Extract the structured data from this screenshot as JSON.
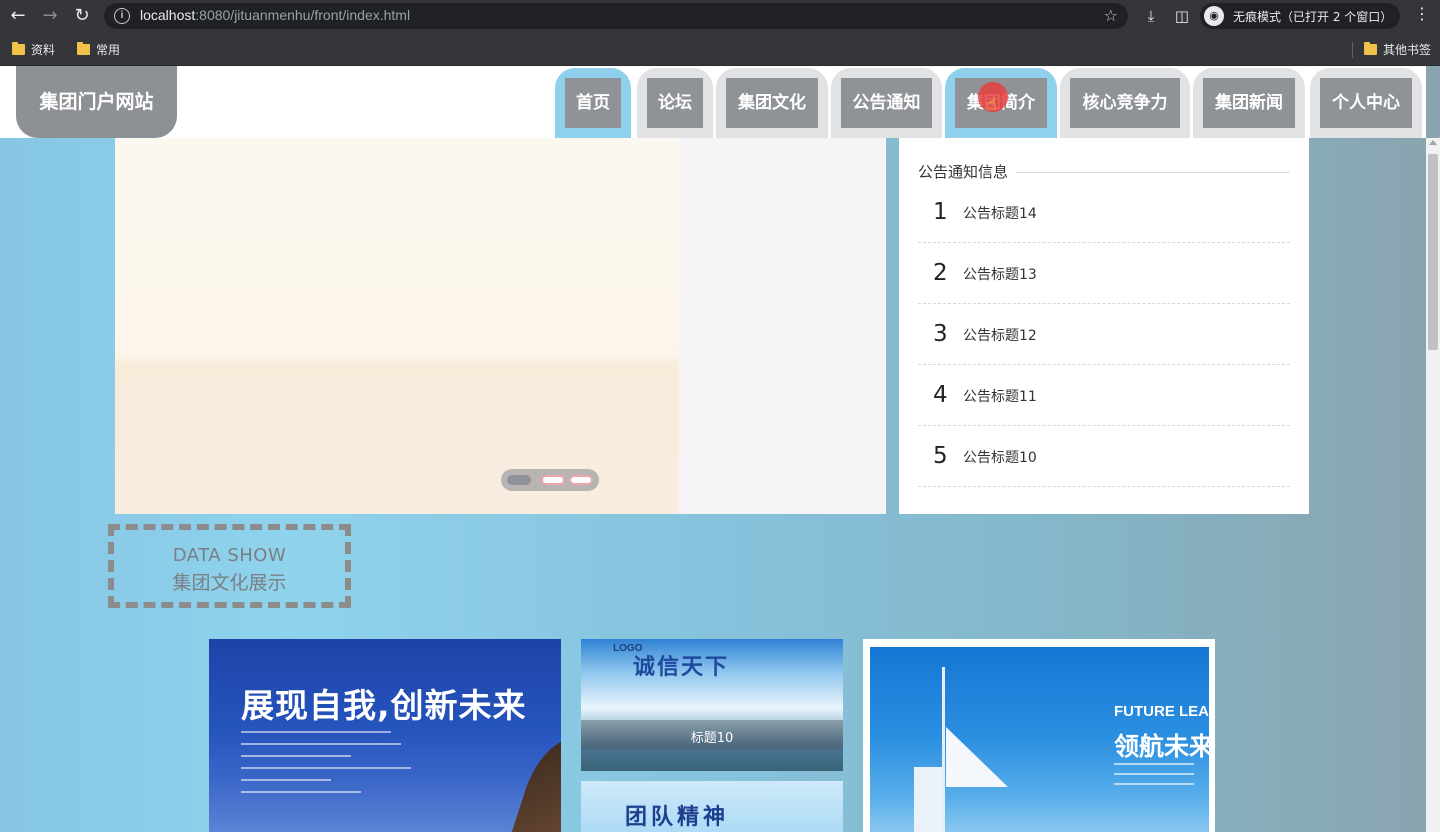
{
  "browser": {
    "url_host": "localhost",
    "url_rest": ":8080/jituanmenhu/front/index.html",
    "incognito_label": "无痕模式（已打开 2 个窗口）",
    "bookmarks": [
      "资料",
      "常用"
    ],
    "other_bookmarks": "其他书签"
  },
  "header": {
    "site_title": "集团门户网站",
    "nav": [
      "首页",
      "论坛",
      "集团文化",
      "公告通知",
      "集团简介",
      "核心竞争力",
      "集团新闻",
      "个人中心"
    ],
    "active_nav": "首页",
    "hovered_nav": "集团简介"
  },
  "notice": {
    "heading": "公告通知信息",
    "items": [
      {
        "num": "1",
        "title": "公告标题14"
      },
      {
        "num": "2",
        "title": "公告标题13"
      },
      {
        "num": "3",
        "title": "公告标题12"
      },
      {
        "num": "4",
        "title": "公告标题11"
      },
      {
        "num": "5",
        "title": "公告标题10"
      }
    ]
  },
  "slider": {
    "dot_count": 3,
    "active_dot": 1
  },
  "datashow": {
    "en": "DATA SHOW",
    "cn": "集团文化展示"
  },
  "gallery": {
    "card_a_headline": "展现自我,创新未来",
    "card_b_logo": "LOGO",
    "card_b_brush": "诚信天下",
    "card_b_caption": "标题10",
    "card_c_brush": "团队精神",
    "card_d_en": "FUTURE LEADER",
    "card_d_cn": "领航未来"
  },
  "colors": {
    "active_tab": "#8fd0ec",
    "tab_inner": "#8f9296",
    "site_title_bg": "#8d9094"
  }
}
